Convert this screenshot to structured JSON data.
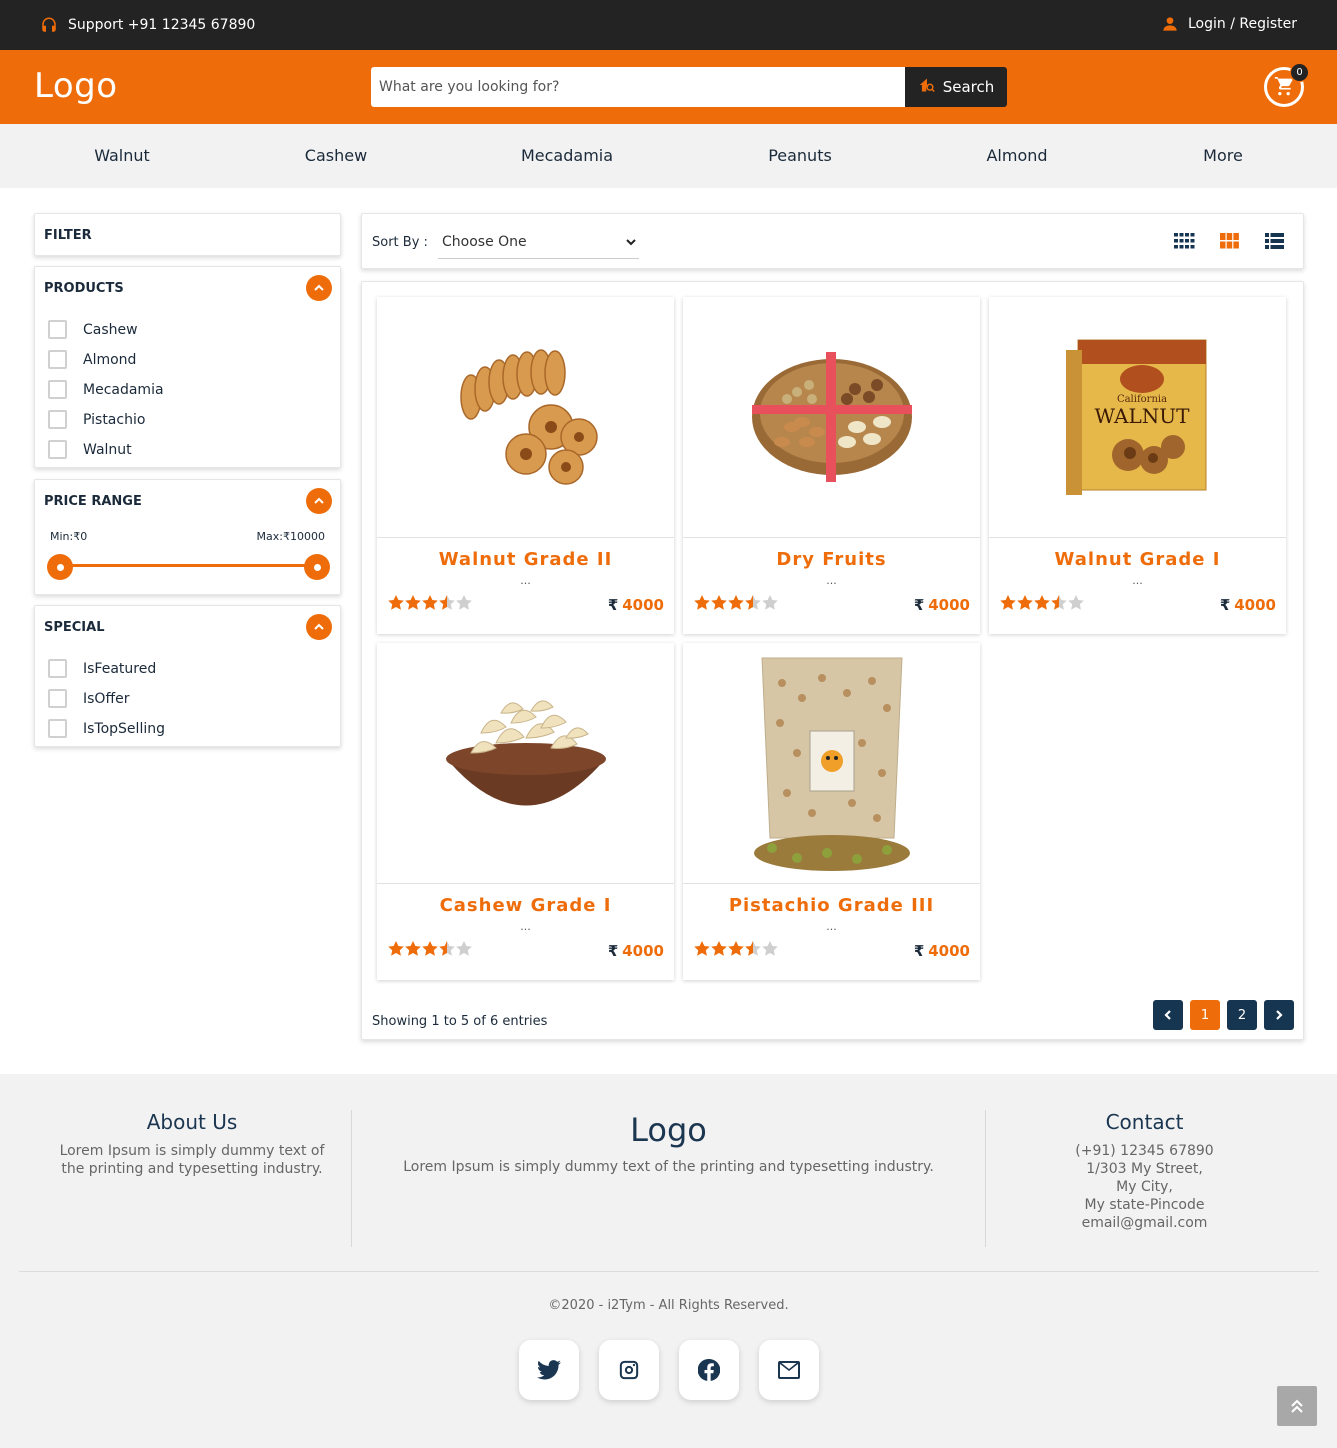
{
  "topbar": {
    "support_text": "Support +91 12345 67890",
    "login_text": "Login / Register"
  },
  "header": {
    "logo": "Logo",
    "search_placeholder": "What are you looking for?",
    "search_button": "Search",
    "cart_count": "0"
  },
  "nav": {
    "items": [
      "Walnut",
      "Cashew",
      "Mecadamia",
      "Peanuts",
      "Almond",
      "More"
    ]
  },
  "filter": {
    "title": "FILTER",
    "products": {
      "title": "PRODUCTS",
      "options": [
        "Cashew",
        "Almond",
        "Mecadamia",
        "Pistachio",
        "Walnut"
      ]
    },
    "price_range": {
      "title": "PRICE RANGE",
      "min_label": "Min:₹0",
      "max_label": "Max:₹10000",
      "min_value": 0,
      "max_value": 10000
    },
    "special": {
      "title": "SPECIAL",
      "options": [
        "IsFeatured",
        "IsOffer",
        "IsTopSelling"
      ]
    }
  },
  "sort": {
    "label": "Sort By :",
    "selected": "Choose One"
  },
  "products": [
    {
      "name": "Walnut Grade II",
      "desc": "...",
      "rating": 3.5,
      "currency": "₹",
      "price": "4000",
      "image": "dried-figs"
    },
    {
      "name": "Dry Fruits",
      "desc": "...",
      "rating": 3.5,
      "currency": "₹",
      "price": "4000",
      "image": "dry-fruit-basket"
    },
    {
      "name": "Walnut Grade I",
      "desc": "...",
      "rating": 3.5,
      "currency": "₹",
      "price": "4000",
      "image": "walnut-box"
    },
    {
      "name": "Cashew Grade I",
      "desc": "...",
      "rating": 3.5,
      "currency": "₹",
      "price": "4000",
      "image": "cashew-bowl"
    },
    {
      "name": "Pistachio Grade III",
      "desc": "...",
      "rating": 3.5,
      "currency": "₹",
      "price": "4000",
      "image": "pistachio-bag"
    }
  ],
  "pagination": {
    "showing": "Showing 1 to 5 of 6 entries",
    "pages": [
      "1",
      "2"
    ],
    "active_page": "1"
  },
  "footer": {
    "about_title": "About Us",
    "about_text": "Lorem Ipsum is simply dummy text of the printing and typesetting industry.",
    "logo": "Logo",
    "logo_text": "Lorem Ipsum is simply dummy text of the printing and typesetting industry.",
    "contact_title": "Contact",
    "contact_lines": [
      "(+91) 12345 67890",
      "1/303 My Street,",
      "My City,",
      "My state-Pincode",
      "email@gmail.com"
    ],
    "copyright": "©2020 - i2Tym - All Rights Reserved.",
    "social": [
      "twitter-icon",
      "instagram-icon",
      "facebook-icon",
      "mail-icon"
    ]
  },
  "colors": {
    "accent": "#ee6d0a",
    "dark": "#232323",
    "navy": "#163550"
  }
}
